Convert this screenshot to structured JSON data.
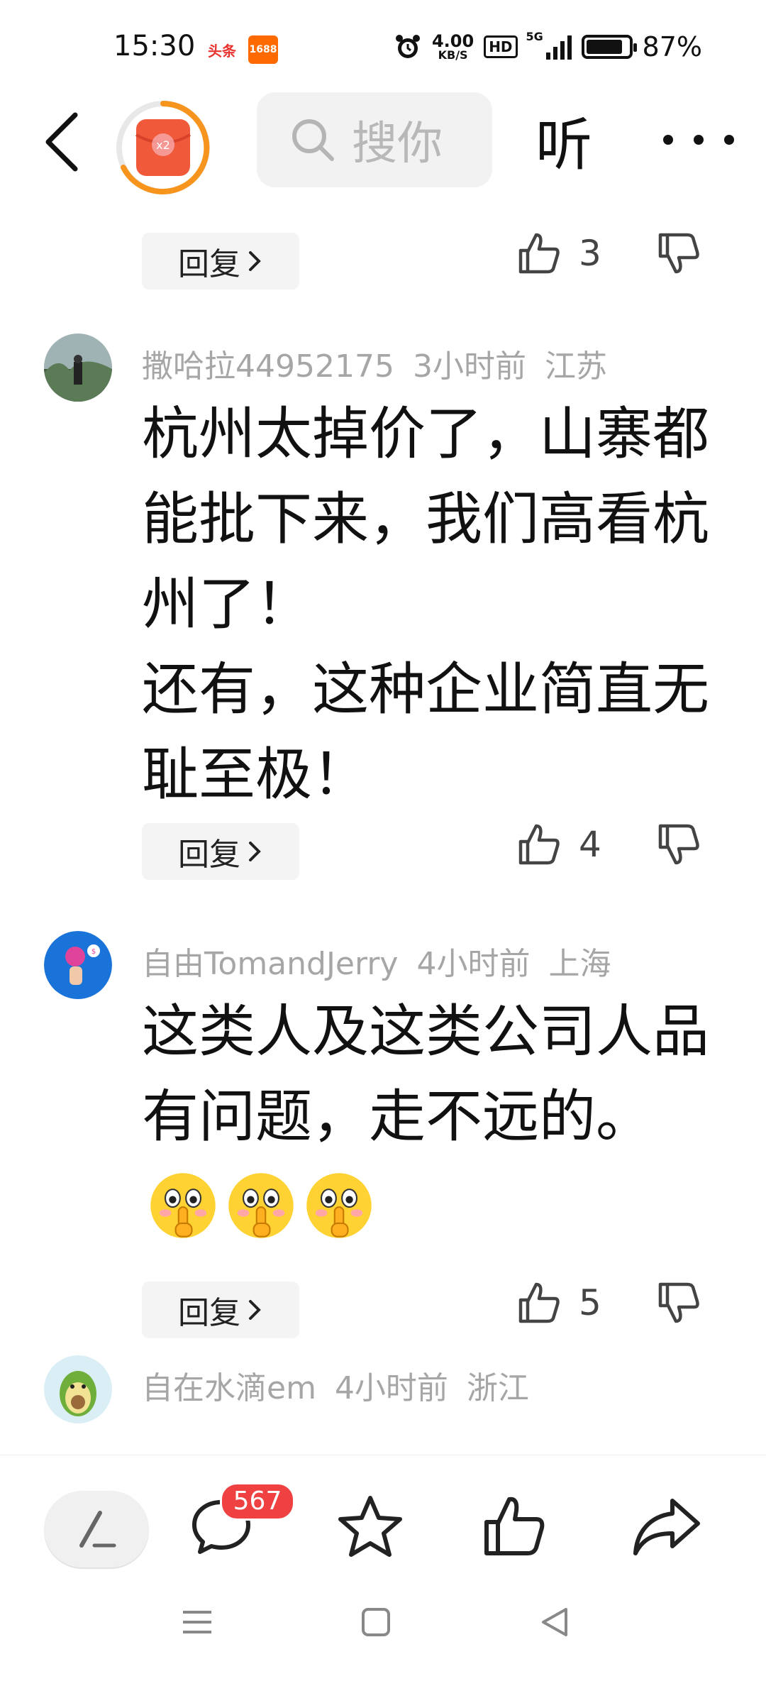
{
  "status_bar": {
    "time": "15:30",
    "app_icons": [
      "头条",
      "1688"
    ],
    "net_speed_value": "4.00",
    "net_speed_unit": "KB/S",
    "hd_label": "HD",
    "network": "5G",
    "battery_percent": "87%",
    "battery_level": 0.87
  },
  "top_bar": {
    "search_placeholder": "搜你",
    "listen_label": "听",
    "redpacket_badge": "x2"
  },
  "comments": [
    {
      "reply_label": "回复",
      "like_count": "3"
    },
    {
      "username": "撒哈拉44952175",
      "time": "3小时前",
      "location": "江苏",
      "text": "杭州太掉价了，山寨都能批下来，我们高看杭州了！\n还有，这种企业简直无耻至极！",
      "reply_label": "回复",
      "like_count": "4"
    },
    {
      "username": "自由TomandJerry",
      "time": "4小时前",
      "location": "上海",
      "text": "这类人及这类公司人品有问题，走不远的。",
      "emoji": "shushing-face-emoji",
      "emoji_count": 3,
      "reply_label": "回复",
      "like_count": "5"
    },
    {
      "username": "自在水滴em",
      "time": "4小时前",
      "location": "浙江"
    }
  ],
  "bottom_bar": {
    "comment_badge": "567"
  },
  "colors": {
    "accent_red": "#f04142",
    "meta_gray": "#a6a6a6",
    "redpacket_orange": "#f7941d"
  }
}
